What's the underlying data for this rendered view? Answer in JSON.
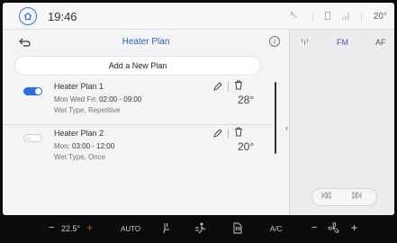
{
  "status_bar": {
    "time": "19:46",
    "outside_temp": "20°"
  },
  "heater_plan": {
    "title": "Heater Plan",
    "add_label": "Add a New Plan",
    "plans": [
      {
        "name": "Heater Plan 1",
        "days": "Mon Wed Fri:",
        "time": "02:00 - 09:00",
        "type": "Wet Type, Repetitive",
        "temp": "28°",
        "enabled": true
      },
      {
        "name": "Heater Plan 2",
        "days": "Mon:",
        "time": "03:00 - 12:00",
        "type": "Wet Type, Once",
        "temp": "20°",
        "enabled": false
      }
    ]
  },
  "radio": {
    "tabs": [
      "FM",
      "AF"
    ],
    "active_tab": "FM"
  },
  "climate_bar": {
    "temp_set": "22.5°",
    "auto_label": "AUTO",
    "ac_label": "A/C"
  },
  "colors": {
    "accent": "#2f6bd9",
    "title_blue": "#2f5fbf",
    "increase_red": "#e53935"
  }
}
